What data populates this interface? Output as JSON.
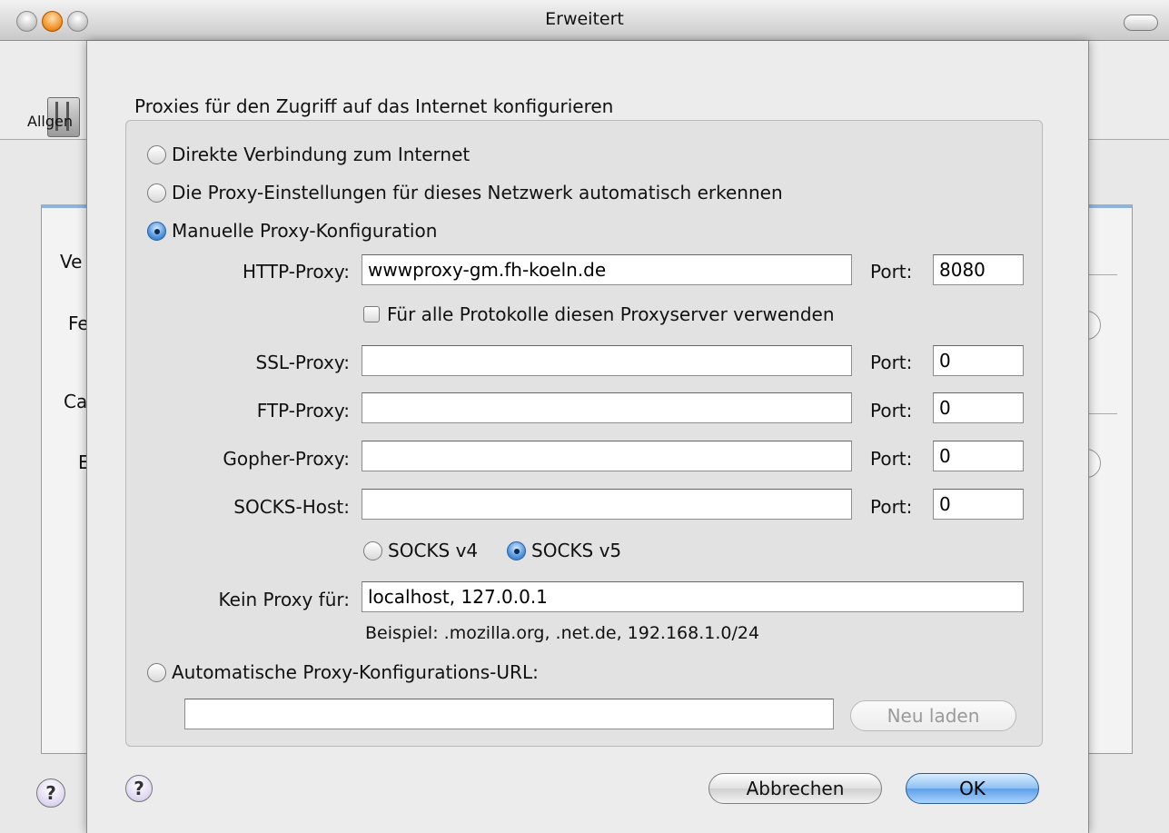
{
  "window": {
    "title": "Erweitert",
    "toolbar_label": "Allgen",
    "bg_labels": [
      "Ve",
      "Fe",
      "Ca",
      "E"
    ],
    "help_glyph": "?"
  },
  "dialog": {
    "heading": "Proxies für den Zugriff auf das Internet konfigurieren",
    "options": {
      "direct": "Direkte Verbindung zum Internet",
      "auto_detect": "Die Proxy-Einstellungen für dieses Netzwerk automatisch erkennen",
      "manual": "Manuelle Proxy-Konfiguration",
      "auto_url": "Automatische Proxy-Konfigurations-URL:"
    },
    "selected_option": "manual",
    "port_label": "Port:",
    "proxies": [
      {
        "label": "HTTP-Proxy:",
        "value": "wwwproxy-gm.fh-koeln.de",
        "port": "8080"
      },
      {
        "label": "SSL-Proxy:",
        "value": "",
        "port": "0"
      },
      {
        "label": "FTP-Proxy:",
        "value": "",
        "port": "0"
      },
      {
        "label": "Gopher-Proxy:",
        "value": "",
        "port": "0"
      },
      {
        "label": "SOCKS-Host:",
        "value": "",
        "port": "0"
      }
    ],
    "same_proxy_checkbox": {
      "label": "Für alle Protokolle diesen Proxyserver verwenden",
      "checked": false
    },
    "socks_versions": [
      {
        "label": "SOCKS v4",
        "selected": false
      },
      {
        "label": "SOCKS v5",
        "selected": true
      }
    ],
    "no_proxy": {
      "label": "Kein Proxy für:",
      "value": "localhost, 127.0.0.1"
    },
    "hint": "Beispiel: .mozilla.org, .net.de, 192.168.1.0/24",
    "auto_url_value": "",
    "reload_button": "Neu laden",
    "cancel_button": "Abbrechen",
    "ok_button": "OK",
    "help_glyph": "?"
  }
}
